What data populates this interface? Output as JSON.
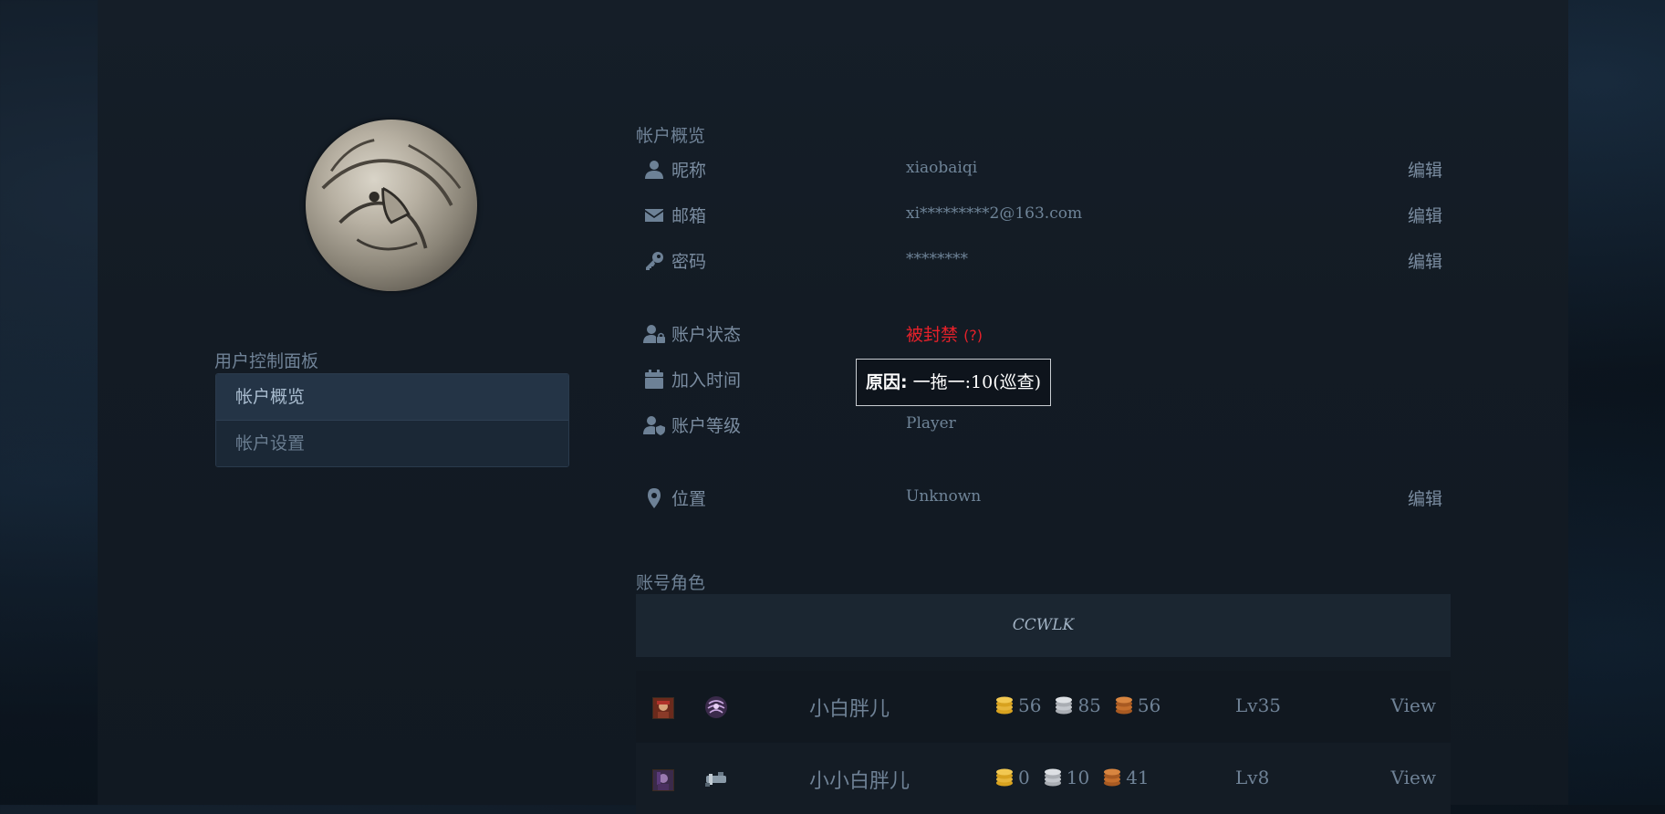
{
  "sidebar": {
    "title": "用户控制面板",
    "items": [
      {
        "label": "帐户概览",
        "active": true
      },
      {
        "label": "帐户设置",
        "active": false
      }
    ]
  },
  "overview": {
    "title": "帐户概览",
    "edit_label": "编辑",
    "nickname": {
      "label": "昵称",
      "value": "xiaobaiqi",
      "icon": "user-icon"
    },
    "email": {
      "label": "邮箱",
      "value": "xi*********2@163.com",
      "icon": "envelope-icon"
    },
    "password": {
      "label": "密码",
      "value": "********",
      "icon": "key-icon"
    },
    "status": {
      "label": "账户状态",
      "value": "被封禁",
      "help": "(?)",
      "icon": "user-lock-icon",
      "color": "#e5212a"
    },
    "joined": {
      "label": "加入时间",
      "value": "",
      "icon": "calendar-icon"
    },
    "level": {
      "label": "账户等级",
      "value": "Player",
      "icon": "user-shield-icon"
    },
    "location": {
      "label": "位置",
      "value": "Unknown",
      "icon": "map-marker-icon"
    }
  },
  "tooltip": {
    "label": "原因:",
    "text": "一拖一:10(巡查)"
  },
  "characters": {
    "title": "账号角色",
    "realm": "CCWLK",
    "view_label": "View",
    "rows": [
      {
        "name": "小白胖儿",
        "gold": "56",
        "silver": "85",
        "copper": "56",
        "level": "Lv35"
      },
      {
        "name": "小小白胖儿",
        "gold": "0",
        "silver": "10",
        "copper": "41",
        "level": "Lv8"
      }
    ]
  },
  "colors": {
    "background": "#0d1620",
    "panel": "#131b24",
    "text": "#7a8ca0",
    "banned": "#e5212a",
    "gold": "#d8a21f",
    "silver": "#c2c6cc",
    "copper": "#c46e2c"
  }
}
